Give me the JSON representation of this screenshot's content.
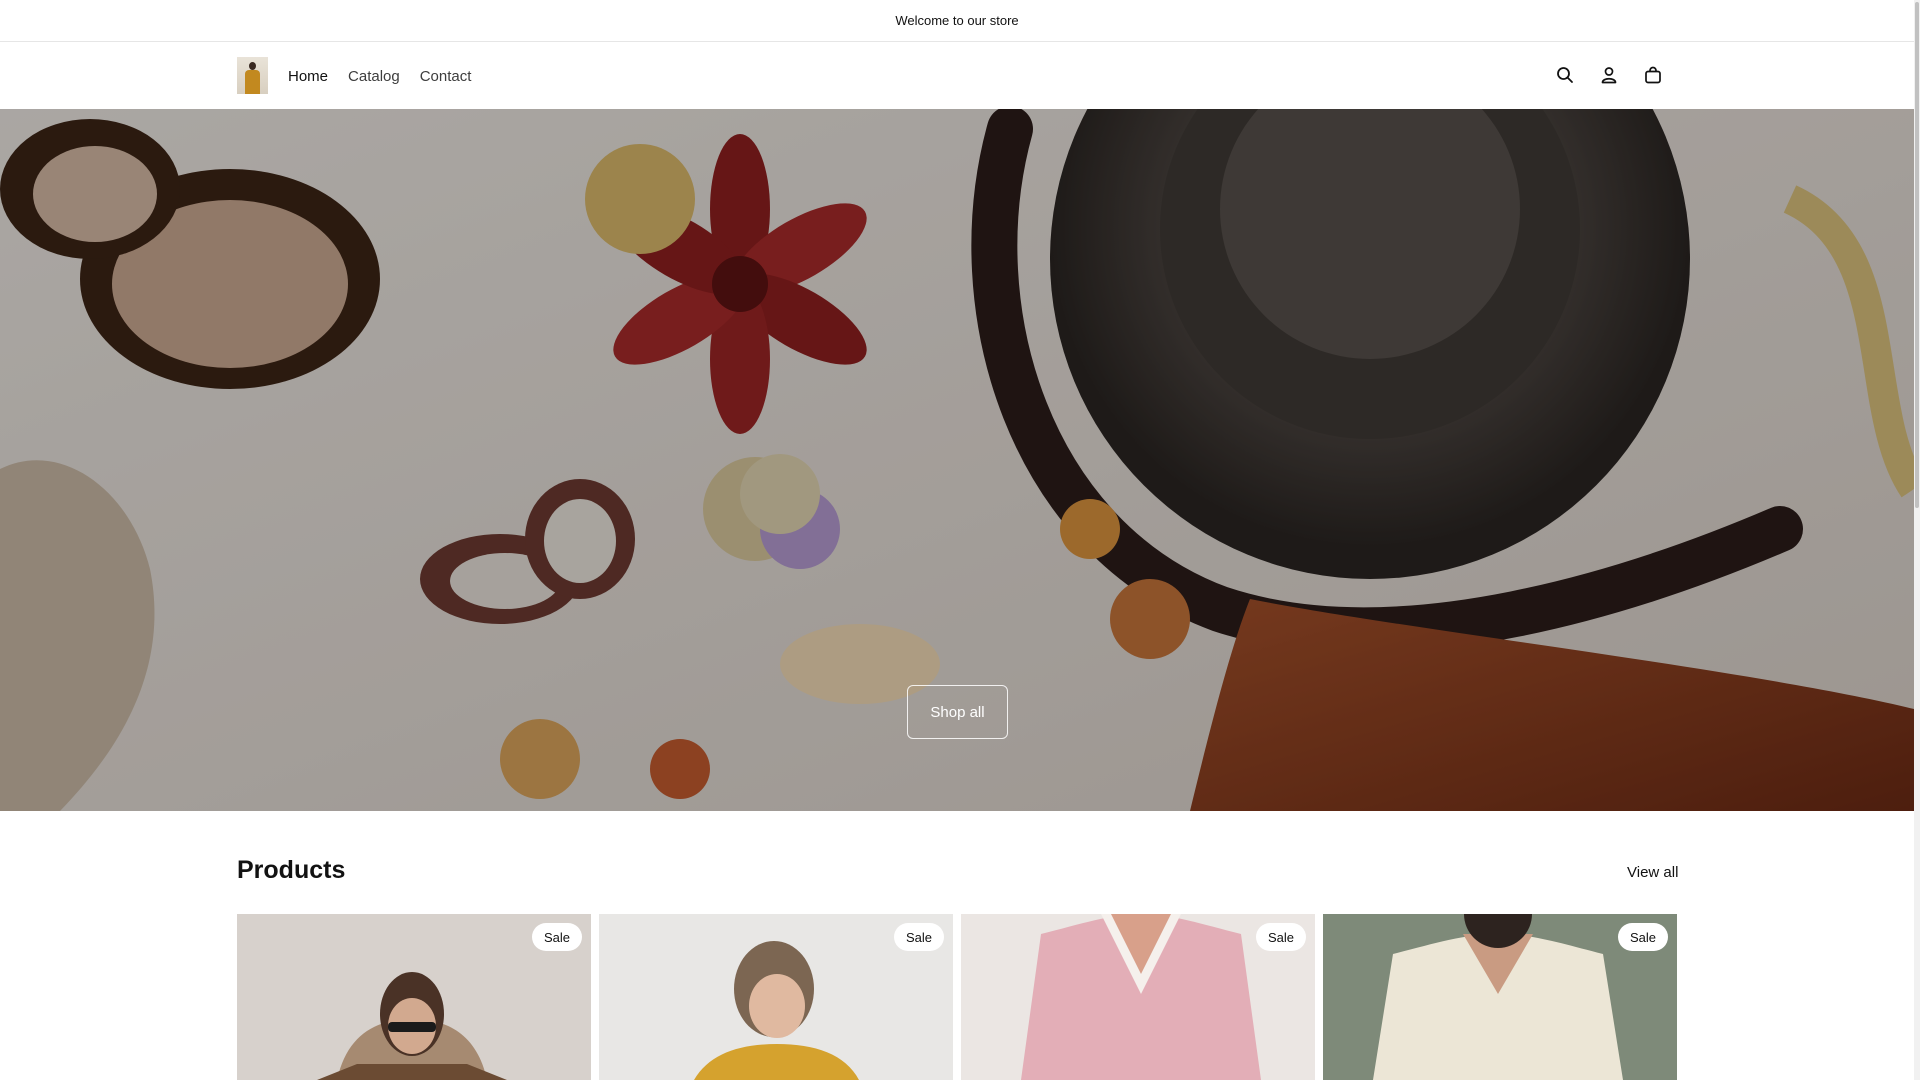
{
  "announcement": {
    "text": "Welcome to our store"
  },
  "header": {
    "logo_alt": "Store logo",
    "nav": [
      {
        "label": "Home",
        "active": true
      },
      {
        "label": "Catalog",
        "active": false
      },
      {
        "label": "Contact",
        "active": false
      }
    ],
    "icons": [
      "search-icon",
      "account-icon",
      "cart-icon"
    ]
  },
  "hero": {
    "button_label": "Shop all",
    "overlay_color": "#000000"
  },
  "products": {
    "title": "Products",
    "view_all_label": "View all",
    "items": [
      {
        "badge": "Sale"
      },
      {
        "badge": "Sale"
      },
      {
        "badge": "Sale"
      },
      {
        "badge": "Sale"
      }
    ]
  }
}
